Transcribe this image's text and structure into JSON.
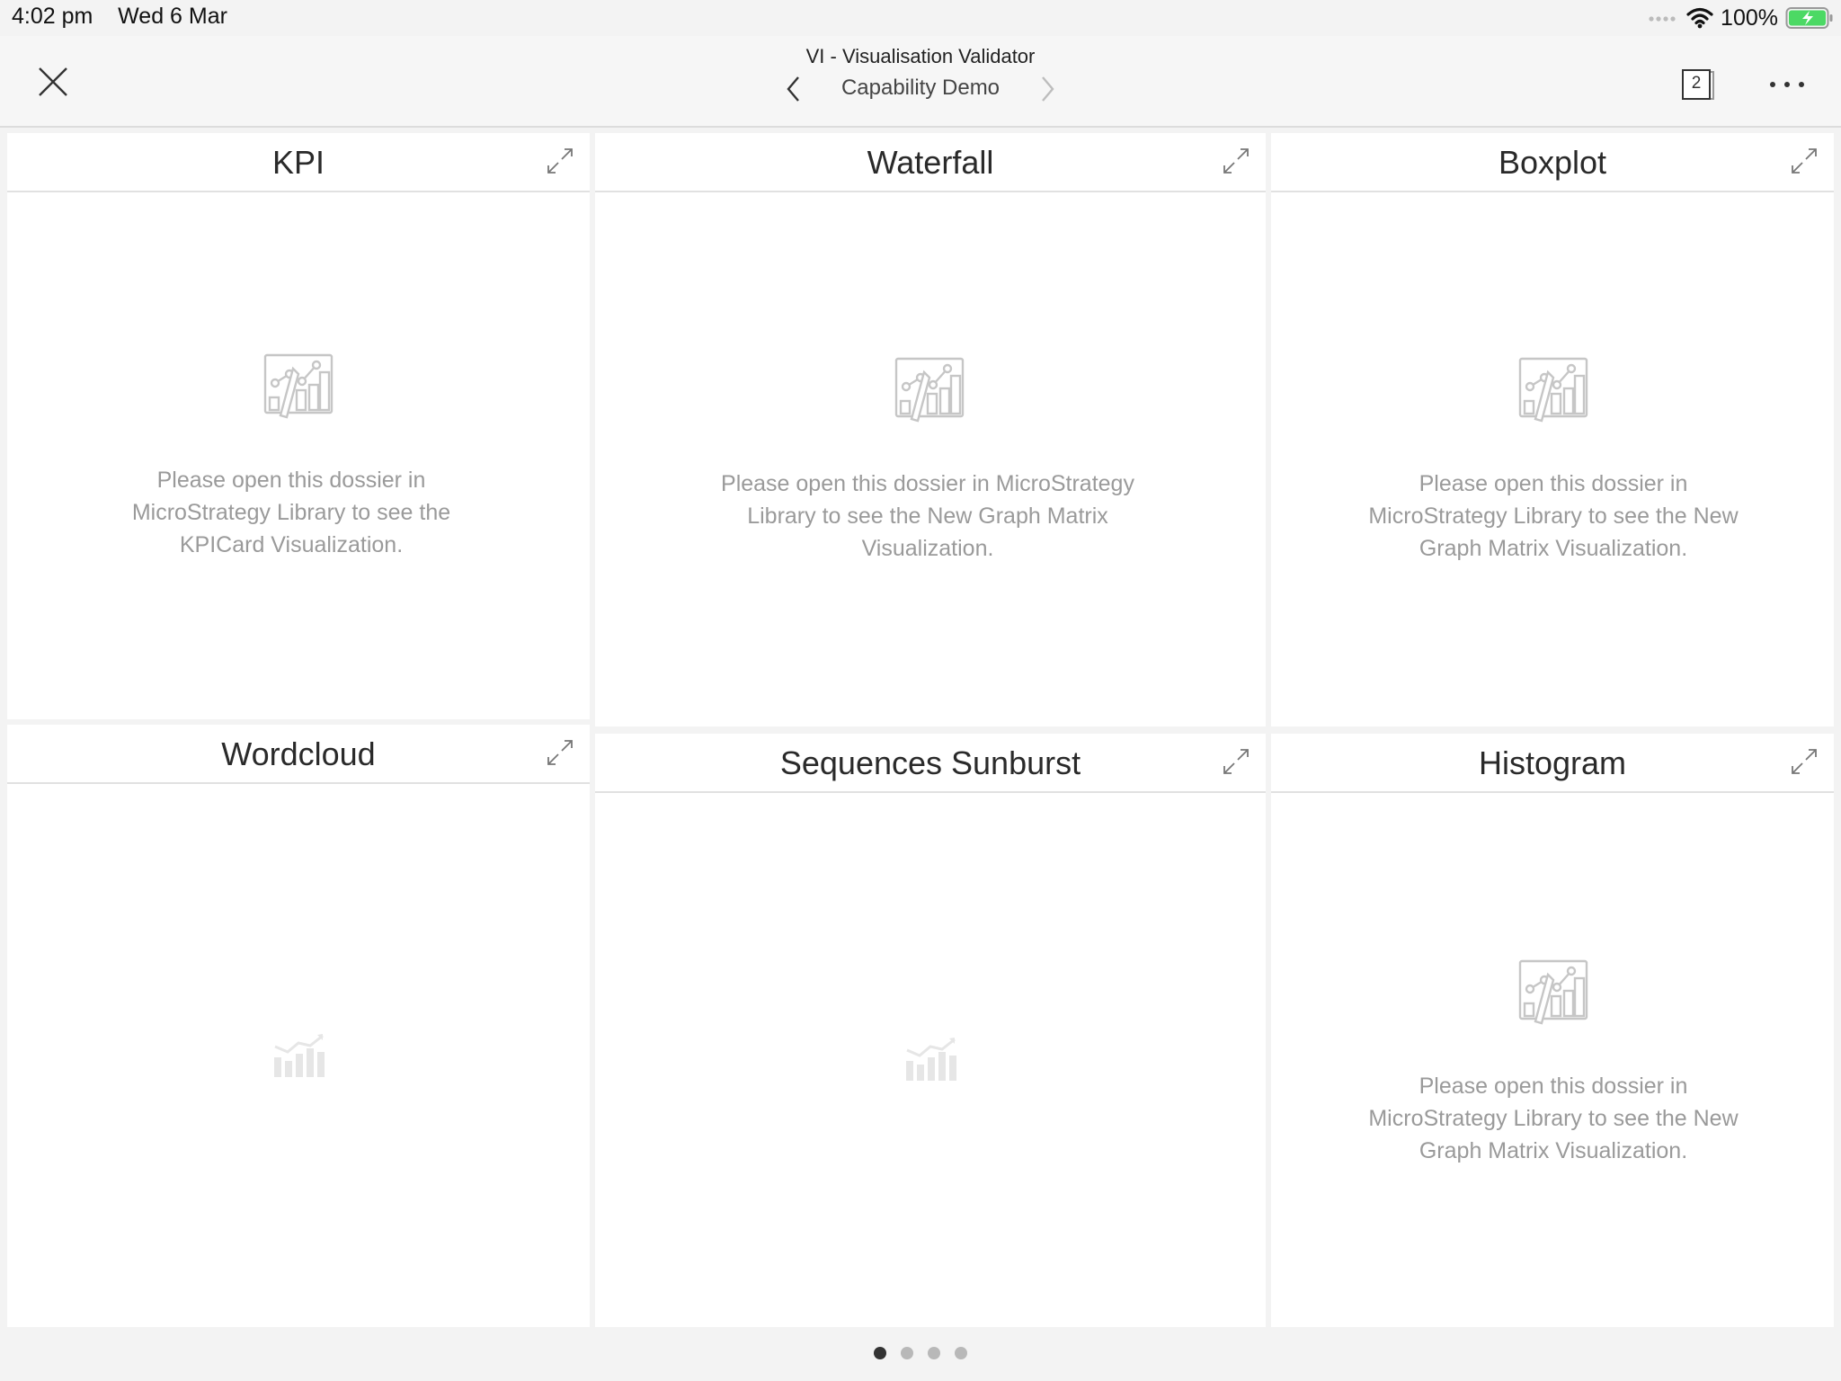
{
  "status_bar": {
    "time": "4:02 pm",
    "date": "Wed 6 Mar",
    "battery_percent": "100%",
    "icons": [
      "signal-dots-icon",
      "wifi-icon",
      "battery-charging-icon"
    ]
  },
  "nav": {
    "title": "VI - Visualisation Validator",
    "chapter": "Capability Demo",
    "page_count": "2",
    "icons": [
      "close-icon",
      "chevron-left-icon",
      "chevron-right-icon",
      "pages-icon",
      "more-icon"
    ]
  },
  "panels": [
    {
      "title": "KPI",
      "message": "Please open this dossier in MicroStrategy Library to see the KPICard Visualization."
    },
    {
      "title": "Waterfall",
      "message": "Please open this dossier in MicroStrategy Library to see the New Graph Matrix Visualization."
    },
    {
      "title": "Boxplot",
      "message": "Please open this dossier in MicroStrategy Library to see the New Graph Matrix Visualization."
    },
    {
      "title": "Wordcloud",
      "message": ""
    },
    {
      "title": "Sequences Sunburst",
      "message": ""
    },
    {
      "title": "Histogram",
      "message": "Please open this dossier in MicroStrategy Library to see the New Graph Matrix Visualization."
    }
  ],
  "pagination": {
    "total": 4,
    "current": 1
  },
  "colors": {
    "battery": "#4cd964",
    "accent": "#333333",
    "placeholder_text": "#9a9a9a"
  }
}
